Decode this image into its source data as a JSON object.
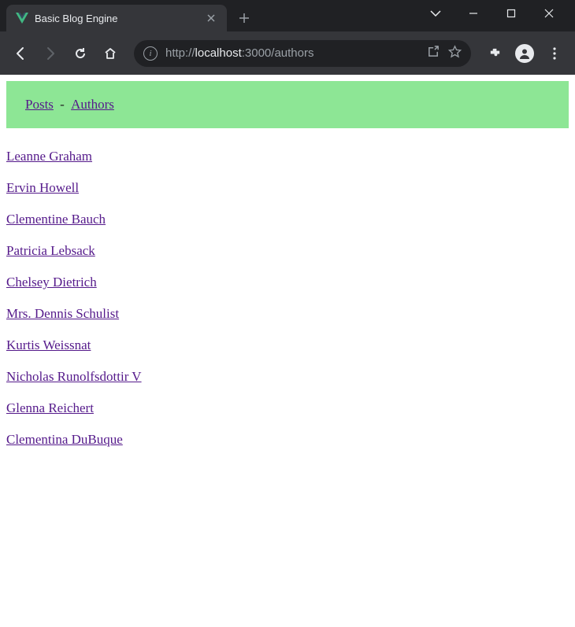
{
  "browser": {
    "tab_title": "Basic Blog Engine",
    "url": {
      "scheme": "http://",
      "host": "localhost",
      "port_path": ":3000/authors"
    }
  },
  "nav": {
    "posts_label": "Posts",
    "separator": " - ",
    "authors_label": "Authors"
  },
  "authors": [
    "Leanne Graham",
    "Ervin Howell",
    "Clementine Bauch",
    "Patricia Lebsack",
    "Chelsey Dietrich",
    "Mrs. Dennis Schulist",
    "Kurtis Weissnat",
    "Nicholas Runolfsdottir V",
    "Glenna Reichert",
    "Clementina DuBuque"
  ]
}
